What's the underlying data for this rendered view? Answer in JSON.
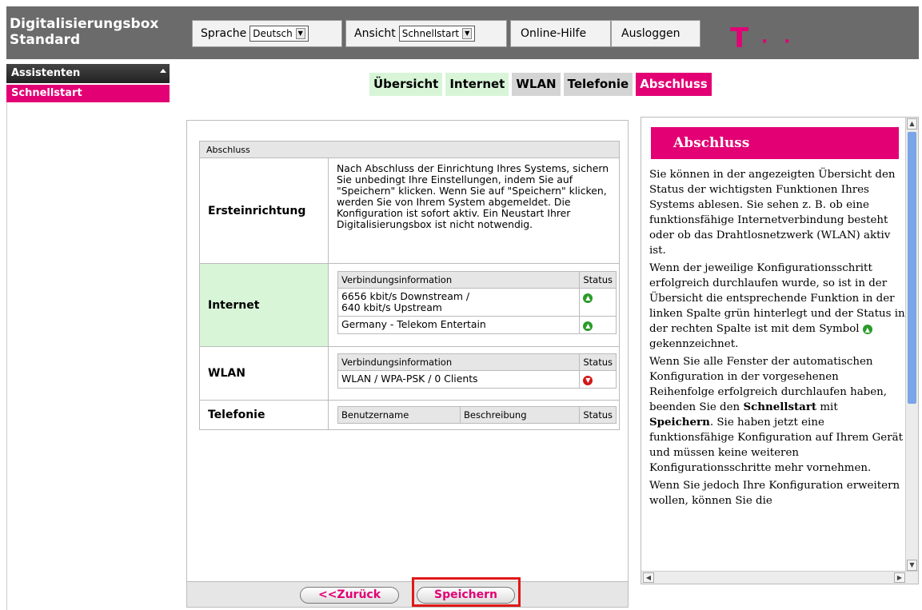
{
  "header": {
    "brand_line1": "Digitalisierungsbox",
    "brand_line2": "Standard",
    "language_label": "Sprache",
    "language_value": "Deutsch",
    "view_label": "Ansicht",
    "view_value": "Schnellstart",
    "help_label": "Online-Hilfe",
    "logout_label": "Ausloggen",
    "logo_text": "T",
    "logo_dots": "· ·"
  },
  "sidebar": {
    "section": "Assistenten",
    "items": [
      {
        "label": "Schnellstart"
      }
    ]
  },
  "tabs": [
    {
      "label": "Übersicht"
    },
    {
      "label": "Internet"
    },
    {
      "label": "WLAN"
    },
    {
      "label": "Telefonie"
    },
    {
      "label": "Abschluss"
    }
  ],
  "main": {
    "section_title": "Abschluss",
    "ersteinrichtung": {
      "label": "Ersteinrichtung",
      "text": "Nach Abschluss der Einrichtung Ihres Systems, sichern Sie unbedingt Ihre Einstellungen, indem Sie auf \"Speichern\" klicken. Wenn Sie auf \"Speichern\" klicken, werden Sie von Ihrem System abgemeldet. Die Konfiguration ist sofort aktiv. Ein Neustart Ihrer Digitalisierungsbox ist nicht notwendig."
    },
    "internet": {
      "label": "Internet",
      "col_info": "Verbindungsinformation",
      "col_status": "Status",
      "rows": [
        {
          "info_line1": "6656 kbit/s Downstream /",
          "info_line2": "640 kbit/s Upstream",
          "status": "ok"
        },
        {
          "info_line1": "Germany - Telekom Entertain",
          "status": "ok"
        }
      ]
    },
    "wlan": {
      "label": "WLAN",
      "col_info": "Verbindungsinformation",
      "col_status": "Status",
      "rows": [
        {
          "info": "WLAN / WPA-PSK / 0 Clients",
          "status": "error"
        }
      ]
    },
    "telefonie": {
      "label": "Telefonie",
      "col_user": "Benutzername",
      "col_desc": "Beschreibung",
      "col_status": "Status"
    },
    "back_label": "<<Zurück",
    "save_label": "Speichern"
  },
  "help": {
    "title": "Abschluss",
    "p1": "Sie können in der angezeigten Übersicht den Status der wichtigsten Funktionen Ihres Systems ablesen. Sie sehen z. B. ob eine funktionsfähige Internetverbindung besteht oder ob das Drahtlosnetzwerk (WLAN) aktiv ist.",
    "p2a": "Wenn der jeweilige Konfigurationsschritt erfolgreich durchlaufen wurde, so ist in der Übersicht die entsprechende Funktion in der linken Spalte grün hinterlegt und der Status in der rechten Spalte ist mit dem Symbol",
    "p2b": "gekennzeichnet.",
    "p3a": "Wenn Sie alle Fenster der automatischen Konfiguration in der vorgesehenen Reihenfolge erfolgreich durchlaufen haben, beenden Sie den",
    "p3_bold1": "Schnellstart",
    "p3_mid": "mit",
    "p3_bold2": "Speichern",
    "p3b": ". Sie haben jetzt eine funktionsfähige Konfiguration auf Ihrem Gerät und müssen keine weiteren Konfigurationsschritte mehr vornehmen.",
    "p4": "Wenn Sie jedoch Ihre Konfiguration erweitern wollen, können Sie die"
  },
  "colors": {
    "magenta": "#e20074",
    "header_grey": "#6b6b6b",
    "ok_green": "#2a9a2a",
    "error_red": "#d01818",
    "highlight_red": "#e01818",
    "green_bg": "#d8f5d8"
  },
  "icons": {
    "status_ok": "arrow-up-circle-icon",
    "status_error": "arrow-down-circle-icon",
    "dropdown": "chevron-down-icon"
  }
}
